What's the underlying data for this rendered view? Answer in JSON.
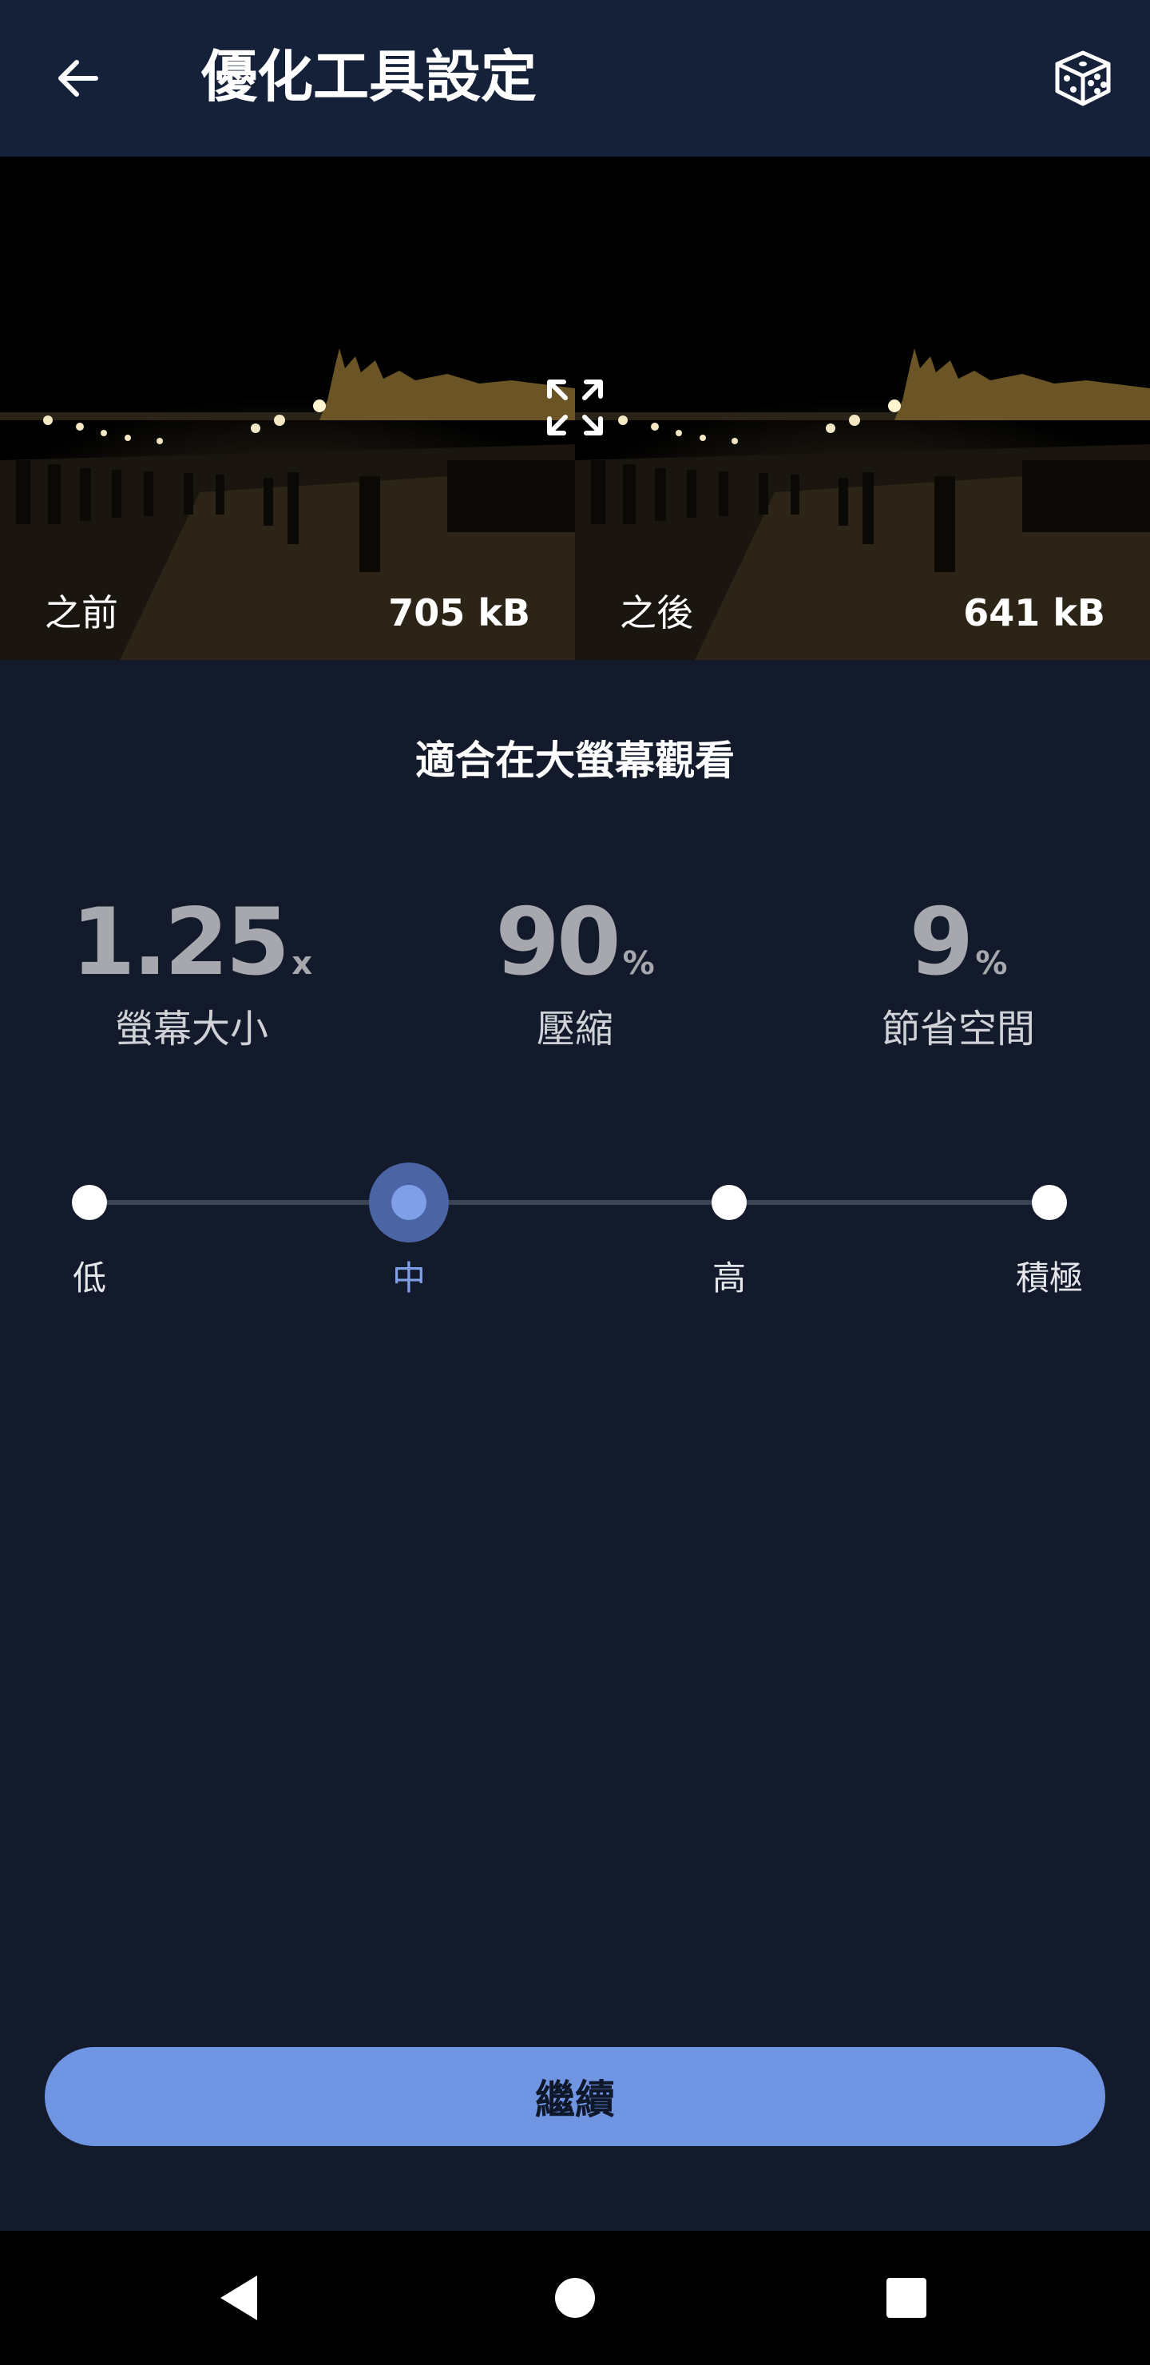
{
  "app_bar": {
    "title": "優化工具設定",
    "back_icon": "arrow-left-icon",
    "random_icon": "dice-icon"
  },
  "preview": {
    "before_label": "之前",
    "before_size": "705 kB",
    "after_label": "之後",
    "after_size": "641 kB",
    "expand_icon": "expand-icon"
  },
  "usage_title": "適合在大螢幕觀看",
  "stats": [
    {
      "value": "1.25",
      "unit": "x",
      "label": "螢幕大小"
    },
    {
      "value": "90",
      "unit": "%",
      "label": "壓縮"
    },
    {
      "value": "9",
      "unit": "%",
      "label": "節省空間"
    }
  ],
  "slider": {
    "levels": [
      "低",
      "中",
      "高",
      "積極"
    ],
    "selected_index": 1
  },
  "continue_label": "繼續",
  "nav": {
    "back_icon": "nav-back-icon",
    "home_icon": "nav-home-icon",
    "recents_icon": "nav-recents-icon"
  },
  "colors": {
    "background": "#121a2b",
    "app_bar": "#152039",
    "accent": "#7095e3",
    "accent_light": "#7f9fe8"
  }
}
